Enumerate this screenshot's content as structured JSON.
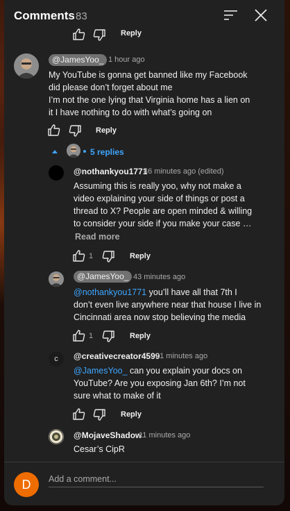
{
  "header": {
    "title": "Comments",
    "count": "83"
  },
  "top_partial": {
    "reply_label": "Reply"
  },
  "comments": [
    {
      "handle": "@JamesYoo_",
      "time": "1 hour ago",
      "lines": [
        "My YouTube is gonna get banned like my Facebook",
        "did please don’t forget about me",
        "I’m not the  one lying that Virginia home has a lien on",
        "it I have nothing to do with what’s going on"
      ],
      "reply_label": "Reply",
      "replies_toggle": "5 replies"
    }
  ],
  "replies": [
    {
      "handle": "@nothankyou1771",
      "time": "46 minutes ago (edited)",
      "lines": [
        "Assuming this is really yoo, why not make a",
        "video explaining your side of things or post a",
        "thread to X? People are open minded & willing",
        "to consider your side if you make your case …"
      ],
      "read_more": "Read more",
      "likes": "1",
      "reply_label": "Reply"
    },
    {
      "handle": "@JamesYoo_",
      "time": "43 minutes ago",
      "mention": "@nothankyou1771",
      "first_line_rest": "  you’ll have all that 7th I",
      "lines": [
        "don’t even live anywhere near that house I live in",
        "Cincinnati area now stop believing the media"
      ],
      "likes": "1",
      "reply_label": "Reply"
    },
    {
      "handle": "@creativecreator4599",
      "time": "21 minutes ago",
      "avatar_letter": "c",
      "mention": "@JamesYoo_",
      "first_line_rest": "  can you explain your docs on",
      "lines": [
        "YouTube? Are you exposing Jan 6th? I’m not",
        "sure what to make of it"
      ],
      "reply_label": "Reply"
    },
    {
      "handle": "@MojaveShadow",
      "time": "11 minutes ago",
      "lines": [
        "Cesar’s CipR"
      ]
    }
  ],
  "composer": {
    "avatar_letter": "D",
    "placeholder": "Add a comment..."
  },
  "colors": {
    "panel": "#212121",
    "link": "#3ea6ff",
    "secondary_text": "#aaaaaa",
    "composer_avatar": "#ef6c00"
  },
  "icons": [
    "sort-icon",
    "close-icon",
    "thumb-up-icon",
    "thumb-down-icon",
    "chevron-up-icon"
  ]
}
